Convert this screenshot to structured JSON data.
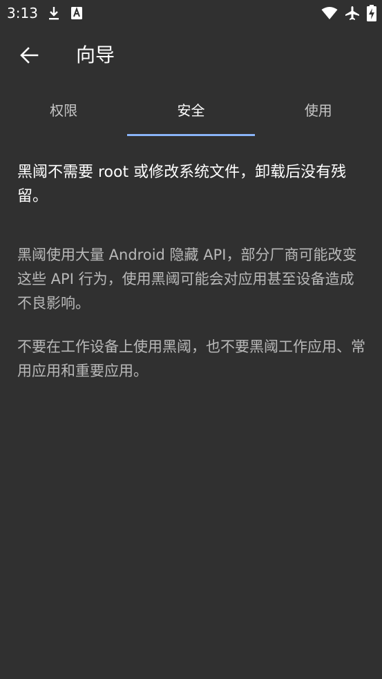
{
  "status_bar": {
    "time": "3:13",
    "left_icons": [
      "download-icon",
      "a-box-icon"
    ],
    "right_icons": [
      "wifi-icon",
      "airplane-icon",
      "battery-charging-icon"
    ]
  },
  "app_bar": {
    "back_icon": "arrow-left-icon",
    "title": "向导"
  },
  "tabs": [
    {
      "label": "权限",
      "active": false
    },
    {
      "label": "安全",
      "active": true
    },
    {
      "label": "使用",
      "active": false
    }
  ],
  "content": {
    "lead": "黑阈不需要 root 或修改系统文件，卸载后没有残留。",
    "paragraphs": [
      "黑阈使用大量 Android 隐藏 API，部分厂商可能改变这些 API 行为，使用黑阈可能会对应用甚至设备造成不良影响。",
      "不要在工作设备上使用黑阈，也不要黑阈工作应用、常用应用和重要应用。"
    ]
  },
  "colors": {
    "background": "#303030",
    "accent": "#8ab4f8"
  }
}
